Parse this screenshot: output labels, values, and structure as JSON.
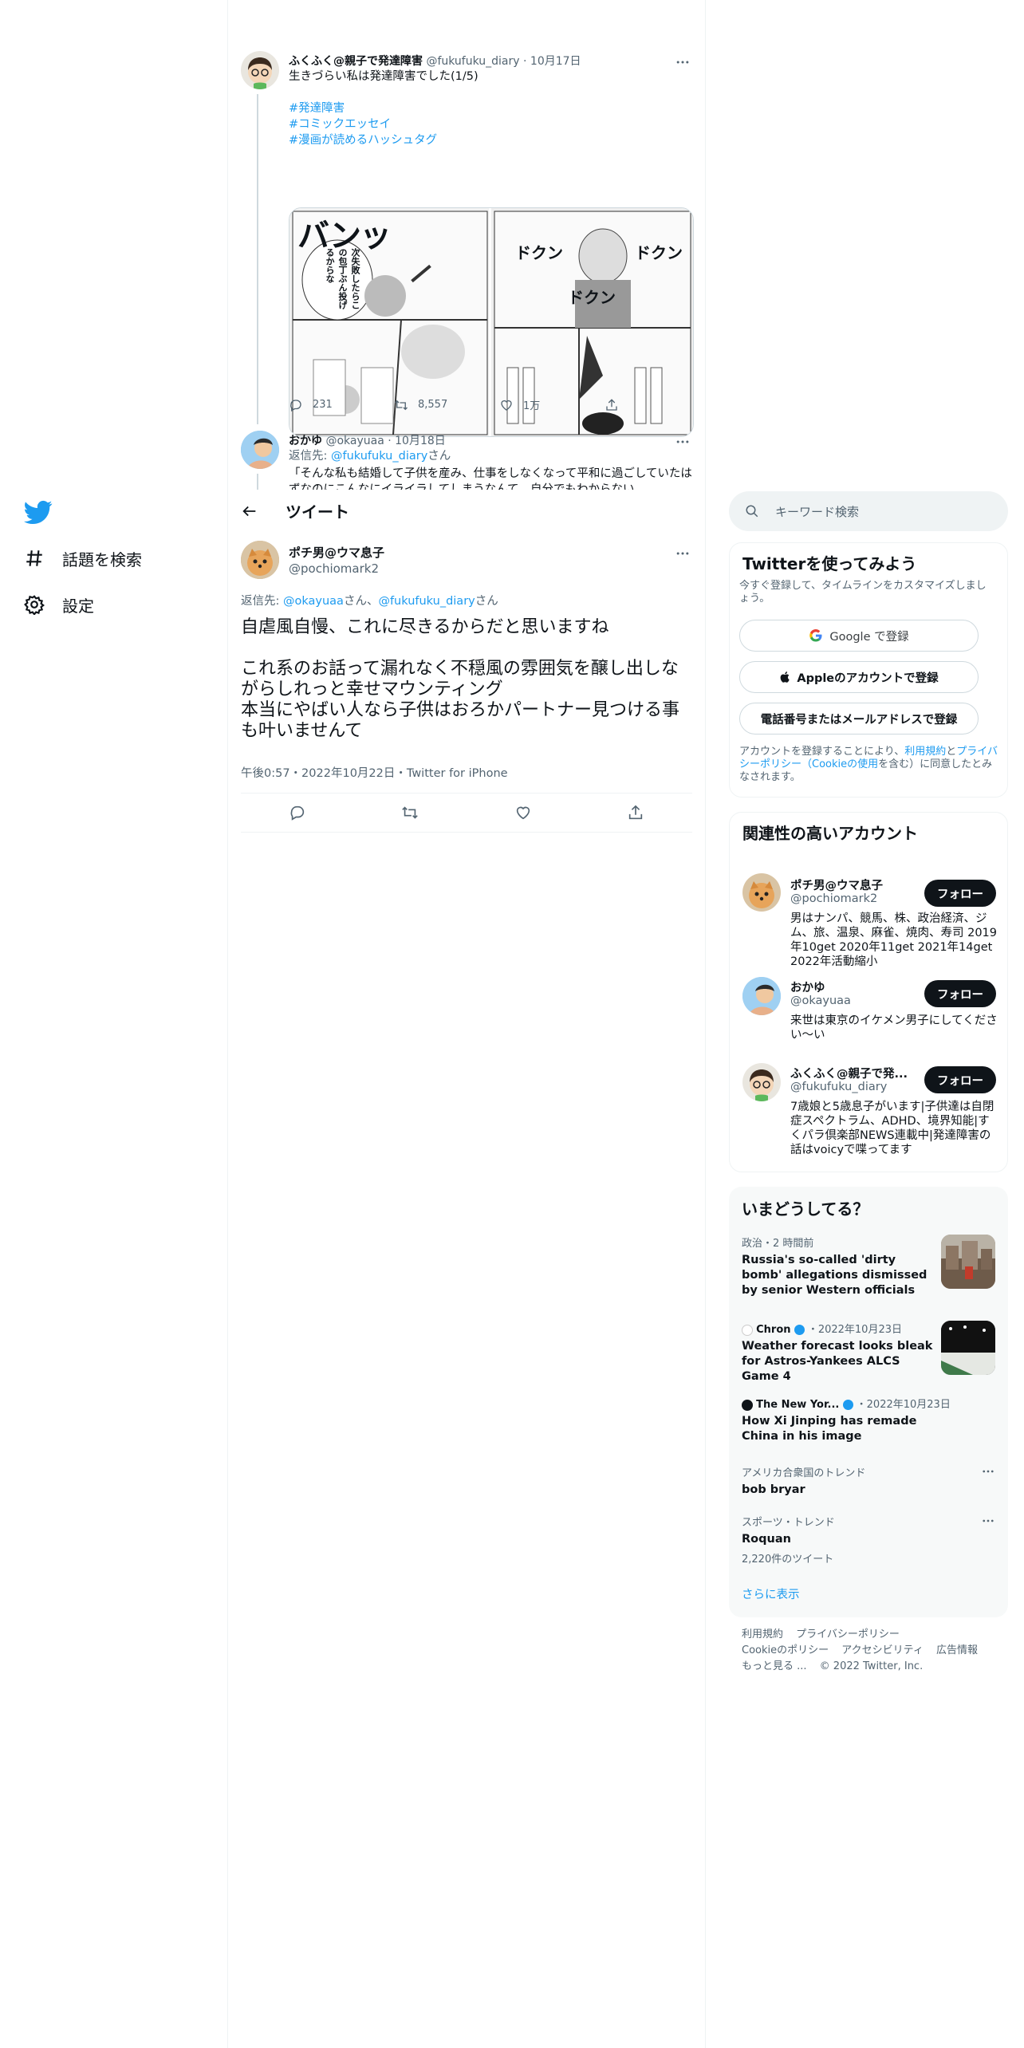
{
  "left_nav": {
    "explore_label": "話題を検索",
    "settings_label": "設定"
  },
  "thread": {
    "tweet1": {
      "name": "ふくふく@親子で発達障害",
      "handle": "@fukufuku_diary",
      "date": "10月17日",
      "text": "生きづらい私は発達障害でした(1/5)",
      "hashtags": [
        "#発達障害",
        "#コミックエッセイ",
        "#漫画が読めるハッシュタグ"
      ],
      "manga_bubble_1": "バンッ",
      "manga_bubble_2": "次失敗したらこの包丁ぶん投げるからな",
      "manga_sfx": "ドクン",
      "replies": "231",
      "retweets": "8,557",
      "likes": "1万"
    },
    "tweet2": {
      "name": "おかゆ",
      "handle": "@okayuaa",
      "date": "10月18日",
      "reply_prefix": "返信先: ",
      "reply_to": "@fukufuku_diary",
      "reply_suffix": "さん",
      "text": "「そんな私も結婚して子供を産み、仕事をしなくなって平和に過ごしていたはずなのにこんなにイライラしてしまうなんて　自分でもわからない"
    }
  },
  "topbar": {
    "title": "ツイート"
  },
  "main_tweet": {
    "name": "ポチ男@ウマ息子",
    "handle": "@pochiomark2",
    "reply_prefix": "返信先: ",
    "reply_to_1": "@okayuaa",
    "reply_mid": "さん、",
    "reply_to_2": "@fukufuku_diary",
    "reply_suffix": "さん",
    "line1": "自虐風自慢、これに尽きるからだと思いますね",
    "line2": "これ系のお話って漏れなく不穏風の雰囲気を醸し出しながらしれっと幸せマウンティング",
    "line3": "本当にやばい人なら子供はおろかパートナー見つける事も叶いませんて",
    "meta": "午後0:57・2022年10月22日・Twitter for iPhone"
  },
  "search": {
    "placeholder": "キーワード検索"
  },
  "signup": {
    "title": "Twitterを使ってみよう",
    "subtitle": "今すぐ登録して、タイムラインをカスタマイズしましょう。",
    "google_button": "Google で登録",
    "apple_button": "Appleのアカウントで登録",
    "phone_button": "電話番号またはメールアドレスで登録",
    "legal_1": "アカウントを登録することにより、",
    "terms_link": "利用規約",
    "legal_2": "と",
    "privacy_link": "プライバシーポリシー（Cookieの使用",
    "legal_3": "を含む）に同意したとみなされます。"
  },
  "related": {
    "title": "関連性の高いアカウント",
    "follow_label": "フォロー",
    "accounts": [
      {
        "name": "ポチ男@ウマ息子",
        "handle": "@pochiomark2",
        "bio": "男はナンパ、競馬、株、政治経済、ジム、旅、温泉、麻雀、焼肉、寿司 2019年10get 2020年11get 2021年14get 2022年活動縮小"
      },
      {
        "name": "おかゆ",
        "handle": "@okayuaa",
        "bio": "来世は東京のイケメン男子にしてください〜い"
      },
      {
        "name": "ふくふく@親子で発...",
        "handle": "@fukufuku_diary",
        "bio": "7歳娘と5歳息子がいます|子供達は自閉症スペクトラム、ADHD、境界知能|すくパラ倶楽部NEWS連載中|発達障害の話はvoicyで喋ってます"
      }
    ]
  },
  "trends": {
    "title": "いまどうしてる？",
    "items": [
      {
        "category": "政治・2 時間前",
        "title": "Russia's so-called 'dirty bomb' allegations dismissed by senior Western officials"
      },
      {
        "category": "Chron",
        "date": "・2022年10月23日",
        "title": "Weather forecast looks bleak for Astros-Yankees ALCS Game 4"
      },
      {
        "category": "The New Yor...",
        "date": "・2022年10月23日",
        "title": "How Xi Jinping has remade China in his image"
      },
      {
        "category": "アメリカ合衆国のトレンド",
        "title": "bob bryar"
      },
      {
        "category": "スポーツ・トレンド",
        "title": "Roquan",
        "count": "2,220件のツイート"
      }
    ],
    "show_more": "さらに表示"
  },
  "footer": {
    "terms": "利用規約",
    "privacy": "プライバシーポリシー",
    "cookie": "Cookieのポリシー",
    "accessibility": "アクセシビリティ",
    "ads": "広告情報",
    "more": "もっと見る ...",
    "copyright": "© 2022 Twitter, Inc."
  },
  "colors": {
    "accent": "#1d9bf0",
    "text": "#0f1419",
    "secondary": "#536471",
    "border": "#eff3f4"
  }
}
